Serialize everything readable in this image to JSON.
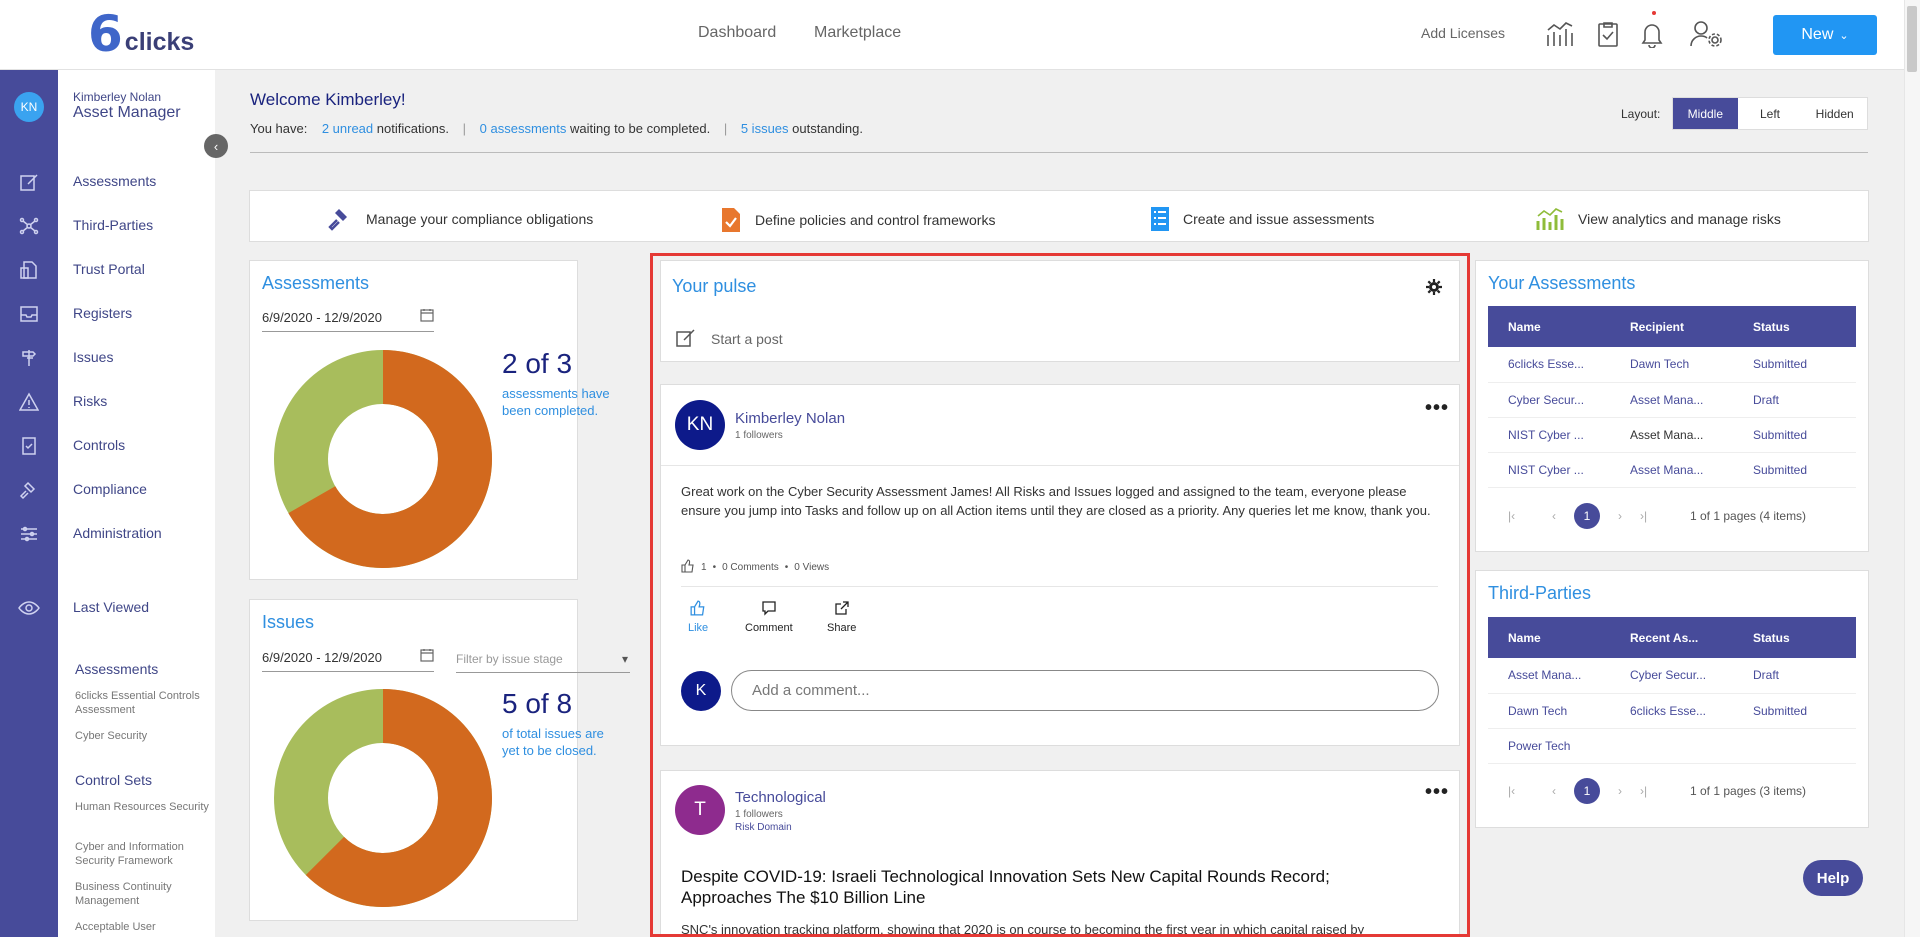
{
  "header": {
    "logo_text": "clicks",
    "logo_digit": "6",
    "nav": [
      "Dashboard",
      "Marketplace"
    ],
    "add_licenses": "Add Licenses",
    "new_button": "New",
    "icons": [
      "analytics-icon",
      "clipboard-check-icon",
      "bell-icon",
      "user-settings-icon"
    ]
  },
  "user": {
    "initials": "KN",
    "name": "Kimberley Nolan",
    "role": "Asset Manager"
  },
  "sidebar": {
    "items": [
      {
        "label": "Assessments",
        "icon": "edit-icon"
      },
      {
        "label": "Third-Parties",
        "icon": "network-icon"
      },
      {
        "label": "Trust Portal",
        "icon": "document-share-icon"
      },
      {
        "label": "Registers",
        "icon": "inbox-icon"
      },
      {
        "label": "Issues",
        "icon": "signpost-icon"
      },
      {
        "label": "Risks",
        "icon": "warning-icon"
      },
      {
        "label": "Controls",
        "icon": "checklist-icon"
      },
      {
        "label": "Compliance",
        "icon": "gavel-icon"
      },
      {
        "label": "Administration",
        "icon": "sliders-icon"
      }
    ],
    "last_viewed": {
      "label": "Last Viewed",
      "icon": "eye-icon"
    },
    "sections": [
      {
        "title": "Assessments",
        "items": [
          "6clicks Essential Controls Assessment",
          "Cyber Security"
        ]
      },
      {
        "title": "Control Sets",
        "items": [
          "Human Resources Security",
          "Cyber and Information Security Framework",
          "Business Continuity Management",
          "Acceptable User"
        ]
      }
    ],
    "collapse_icon": "chevron-left-icon"
  },
  "welcome": {
    "title": "Welcome Kimberley!",
    "prefix": "You have:",
    "unread_link": "2 unread",
    "unread_text": "notifications.",
    "assess_link": "0 assessments",
    "assess_text": "waiting to be completed.",
    "issues_link": "5 issues",
    "issues_text": "outstanding.",
    "separator": "|"
  },
  "layout": {
    "label": "Layout:",
    "options": [
      "Middle",
      "Left",
      "Hidden"
    ],
    "selected": "Middle"
  },
  "features": [
    {
      "label": "Manage your compliance obligations",
      "icon": "gavel-icon",
      "color": "#474b9a"
    },
    {
      "label": "Define policies and control frameworks",
      "icon": "document-check-icon",
      "color": "#e8772e"
    },
    {
      "label": "Create and issue assessments",
      "icon": "list-icon",
      "color": "#2196f3"
    },
    {
      "label": "View analytics and manage risks",
      "icon": "chart-icon",
      "color": "#8fbc3a"
    }
  ],
  "assessments_card": {
    "title": "Assessments",
    "date_range": "6/9/2020 - 12/9/2020",
    "big": "2 of 3",
    "desc": "assessments have been completed.",
    "completed_fraction": 0.667,
    "colors": {
      "done": "#d2691e",
      "rest": "#a8bd5c"
    }
  },
  "issues_card": {
    "title": "Issues",
    "date_range": "6/9/2020 - 12/9/2020",
    "filter_placeholder": "Filter by issue stage",
    "big": "5 of 8",
    "desc": "of total issues are yet to be closed.",
    "open_fraction": 0.625
  },
  "pulse": {
    "title": "Your pulse",
    "start_post": "Start a post",
    "posts": [
      {
        "initials": "KN",
        "name": "Kimberley Nolan",
        "followers": "1 followers",
        "body": "Great work on the Cyber Security Assessment James! All Risks and Issues logged and assigned to the team, everyone please ensure you jump into Tasks and follow up on all Action items until they are closed as a priority. Any queries let me know, thank you.",
        "likes": "1",
        "comments": "0 Comments",
        "views": "0 Views",
        "actions": [
          "Like",
          "Comment",
          "Share"
        ],
        "comment_initial": "K",
        "comment_placeholder": "Add a comment..."
      },
      {
        "initials": "T",
        "name": "Technological",
        "followers": "1 followers",
        "domain": "Risk Domain",
        "headline": "Despite COVID-19: Israeli Technological Innovation Sets New Capital Rounds Record; Approaches The $10 Billion Line",
        "snippet": "SNC's innovation tracking platform, showing that 2020 is on course to becoming the first year in which capital raised by"
      }
    ]
  },
  "your_assessments": {
    "title": "Your Assessments",
    "columns": [
      "Name",
      "Recipient",
      "Status"
    ],
    "rows": [
      [
        "6clicks Esse...",
        "Dawn Tech",
        "Submitted"
      ],
      [
        "Cyber Secur...",
        "Asset Mana...",
        "Draft"
      ],
      [
        "NIST Cyber ...",
        "Asset Mana...",
        "Submitted"
      ],
      [
        "NIST Cyber ...",
        "Asset Mana...",
        "Submitted"
      ]
    ],
    "page": "1",
    "page_info": "1 of 1 pages (4 items)"
  },
  "third_parties": {
    "title": "Third-Parties",
    "columns": [
      "Name",
      "Recent As...",
      "Status"
    ],
    "rows": [
      [
        "Asset Mana...",
        "Cyber Secur...",
        "Draft"
      ],
      [
        "Dawn Tech",
        "6clicks Esse...",
        "Submitted"
      ],
      [
        "Power Tech",
        "",
        ""
      ]
    ],
    "page": "1",
    "page_info": "1 of 1 pages (3 items)"
  },
  "pager_glyphs": [
    "|‹",
    "‹",
    "›",
    "›|"
  ],
  "help": "Help"
}
